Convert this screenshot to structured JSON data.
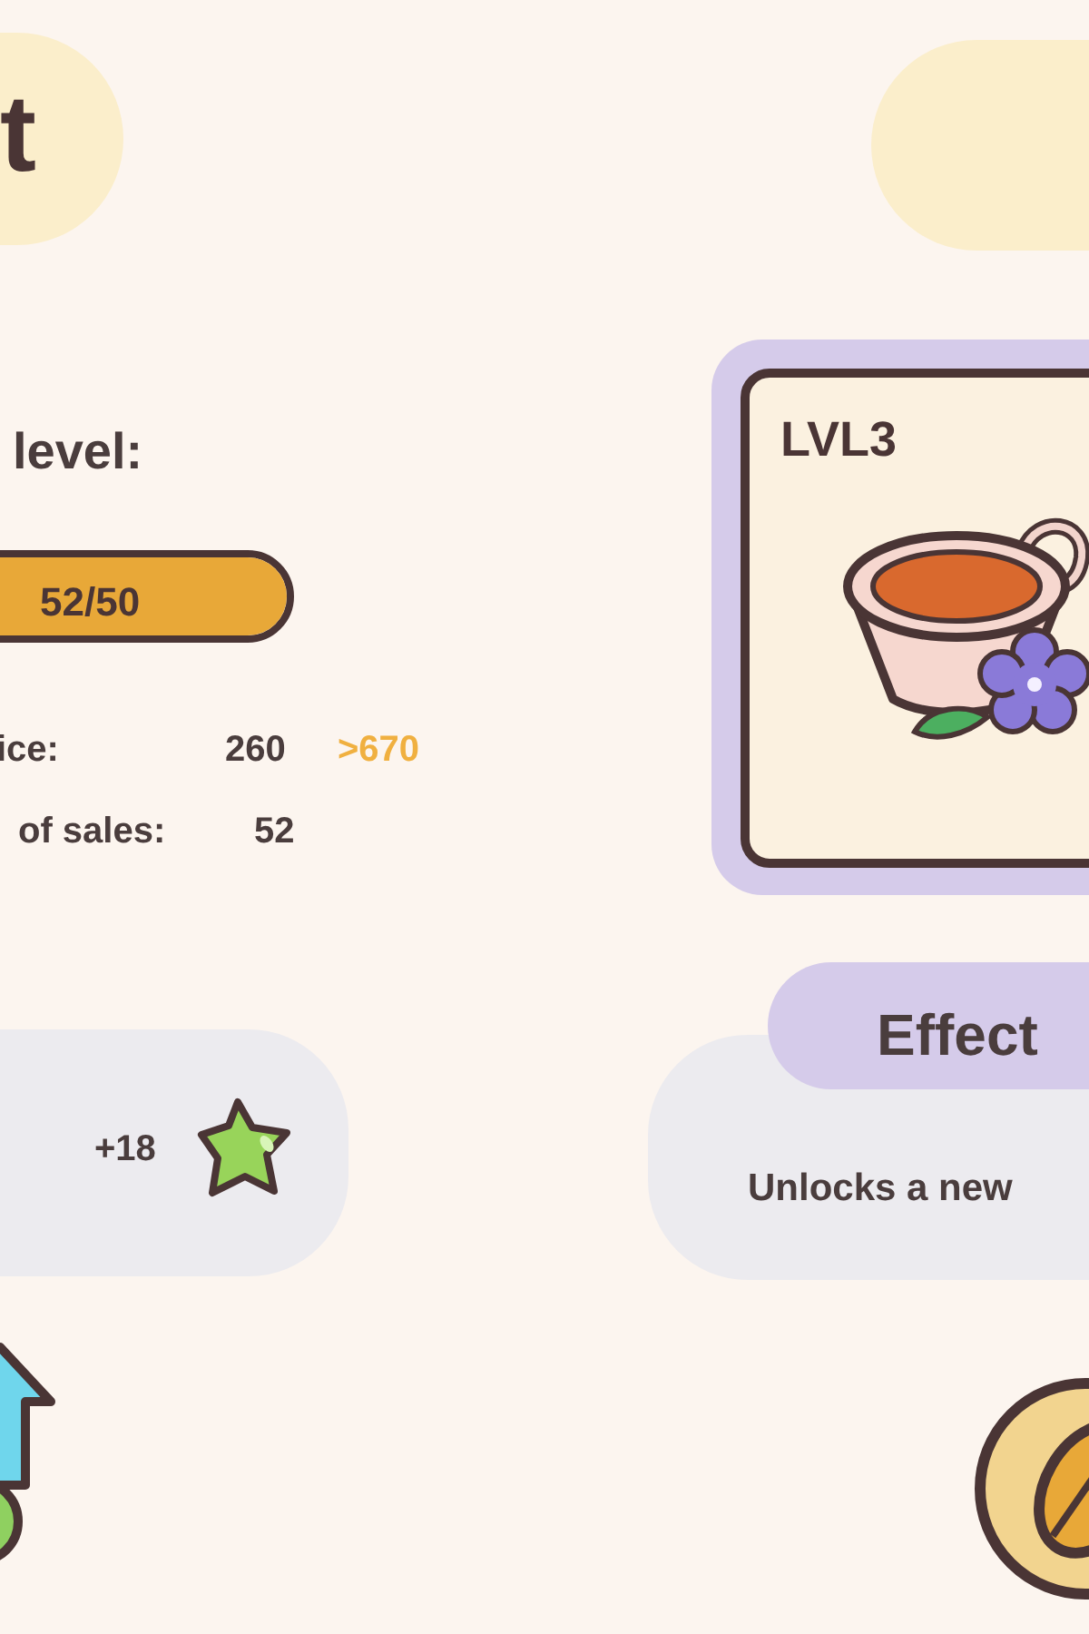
{
  "title": {
    "text": "t"
  },
  "upgrade": {
    "label": "level:",
    "progress": {
      "reading": "52/50",
      "level": 1
    }
  },
  "stats": [
    {
      "label": "ice:",
      "value": "260",
      "new_value": ">670"
    },
    {
      "label": "of sales:",
      "value": "52"
    }
  ],
  "reward": {
    "amount": "+18"
  },
  "item_card": {
    "level_label": "LVL3"
  },
  "effect": {
    "title": "Effect",
    "description": "Unlocks a new"
  }
}
